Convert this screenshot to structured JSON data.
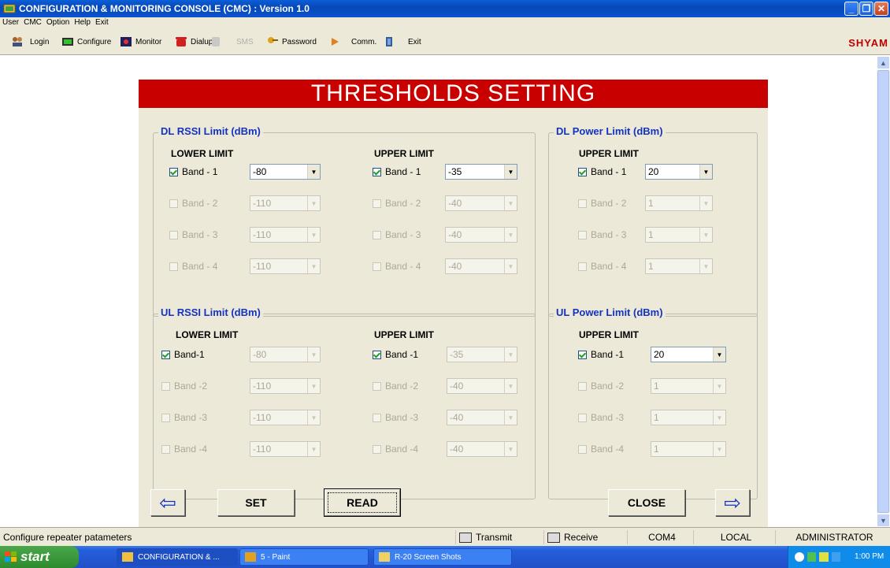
{
  "window": {
    "title": "CONFIGURATION & MONITORING CONSOLE (CMC)  :  Version 1.0",
    "controls": {
      "minimize": "_",
      "maximize": "❐",
      "close": "✕"
    }
  },
  "menu": [
    "User",
    "CMC",
    "Option",
    "Help",
    "Exit"
  ],
  "toolbar": {
    "login": "Login",
    "configure": "Configure",
    "monitor": "Monitor",
    "dialup": "Dialup",
    "sms": "SMS",
    "password": "Password",
    "comm": "Comm.",
    "exit": "Exit",
    "brand": "SHYAM"
  },
  "page": {
    "heading": "THRESHOLDS SETTING",
    "dl_rssi": {
      "legend": "DL RSSI Limit (dBm)",
      "lower_head": "LOWER LIMIT",
      "upper_head": "UPPER LIMIT",
      "lower": [
        {
          "label": "Band - 1",
          "value": "-80",
          "checked": true,
          "enabled": true
        },
        {
          "label": "Band - 2",
          "value": "-110",
          "checked": false,
          "enabled": false
        },
        {
          "label": "Band - 3",
          "value": "-110",
          "checked": false,
          "enabled": false
        },
        {
          "label": "Band - 4",
          "value": "-110",
          "checked": false,
          "enabled": false
        }
      ],
      "upper": [
        {
          "label": "Band - 1",
          "value": "-35",
          "checked": true,
          "enabled": true
        },
        {
          "label": "Band - 2",
          "value": "-40",
          "checked": false,
          "enabled": false
        },
        {
          "label": "Band - 3",
          "value": "-40",
          "checked": false,
          "enabled": false
        },
        {
          "label": "Band - 4",
          "value": "-40",
          "checked": false,
          "enabled": false
        }
      ]
    },
    "dl_power": {
      "legend": "DL Power Limit (dBm)",
      "upper_head": "UPPER LIMIT",
      "upper": [
        {
          "label": "Band - 1",
          "value": "20",
          "checked": true,
          "enabled": true
        },
        {
          "label": "Band - 2",
          "value": "1",
          "checked": false,
          "enabled": false
        },
        {
          "label": "Band - 3",
          "value": "1",
          "checked": false,
          "enabled": false
        },
        {
          "label": "Band - 4",
          "value": "1",
          "checked": false,
          "enabled": false
        }
      ]
    },
    "ul_rssi": {
      "legend": "UL RSSI Limit (dBm)",
      "lower_head": "LOWER LIMIT",
      "upper_head": "UPPER LIMIT",
      "lower": [
        {
          "label": "Band-1",
          "value": "-80",
          "checked": true,
          "enabled": false
        },
        {
          "label": "Band -2",
          "value": "-110",
          "checked": false,
          "enabled": false
        },
        {
          "label": "Band -3",
          "value": "-110",
          "checked": false,
          "enabled": false
        },
        {
          "label": "Band -4",
          "value": "-110",
          "checked": false,
          "enabled": false
        }
      ],
      "upper": [
        {
          "label": "Band -1",
          "value": "-35",
          "checked": true,
          "enabled": false
        },
        {
          "label": "Band -2",
          "value": "-40",
          "checked": false,
          "enabled": false
        },
        {
          "label": "Band -3",
          "value": "-40",
          "checked": false,
          "enabled": false
        },
        {
          "label": "Band -4",
          "value": "-40",
          "checked": false,
          "enabled": false
        }
      ]
    },
    "ul_power": {
      "legend": "UL Power Limit (dBm)",
      "upper_head": "UPPER LIMIT",
      "upper": [
        {
          "label": "Band -1",
          "value": "20",
          "checked": true,
          "enabled": true
        },
        {
          "label": "Band -2",
          "value": "1",
          "checked": false,
          "enabled": false
        },
        {
          "label": "Band -3",
          "value": "1",
          "checked": false,
          "enabled": false
        },
        {
          "label": "Band -4",
          "value": "1",
          "checked": false,
          "enabled": false
        }
      ]
    },
    "buttons": {
      "back": "⇦",
      "set": "SET",
      "read": "READ",
      "close": "CLOSE",
      "next": "⇨"
    }
  },
  "status": {
    "message": "Configure repeater patameters",
    "transmit": "Transmit",
    "receive": "Receive",
    "port": "COM4",
    "mode": "LOCAL",
    "user": "ADMINISTRATOR"
  },
  "taskbar": {
    "start": "start",
    "tasks": [
      "CONFIGURATION & ...",
      "5 - Paint",
      "R-20 Screen Shots"
    ],
    "clock": "1:00 PM"
  },
  "colors": {
    "banner": "#c90000",
    "legend": "#1433c0",
    "brand": "#c00000"
  }
}
